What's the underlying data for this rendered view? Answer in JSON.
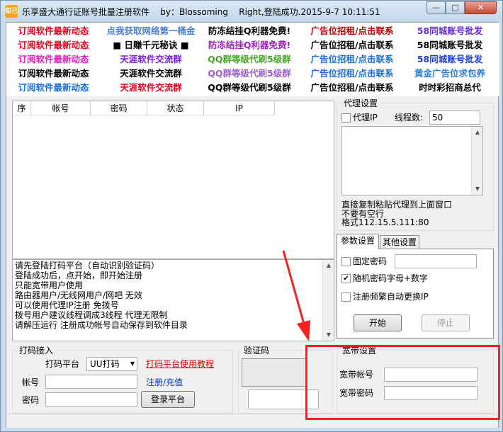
{
  "window": {
    "app_icon": "知己",
    "title": "乐享盛大通行证账号批量注册软件    by：Blossoming    Right,登陆成功.2015-9-7 10:11:51",
    "min_label": "—",
    "max_label": "□",
    "close_label": "✕"
  },
  "ads": [
    [
      {
        "text": "订阅软件最新动态",
        "color": "#e8001c"
      },
      {
        "text": "点我获取网络第一桶金",
        "color": "#4a7fd6"
      },
      {
        "text": "防冻结挂Q利器免费!",
        "color": "#000000"
      },
      {
        "text": "广告位招租/点击联系",
        "color": "#c00000"
      },
      {
        "text": "58同城账号批发",
        "color": "#6a2bd9"
      }
    ],
    [
      {
        "text": "订阅软件最新动态",
        "color": "#e8001c"
      },
      {
        "text": "■  日赚千元秘诀  ■",
        "color": "#000000"
      },
      {
        "text": "防冻结挂Q利器免费!",
        "color": "#a020c0"
      },
      {
        "text": "广告位招租/点击联系",
        "color": "#000000"
      },
      {
        "text": "58同城账号批发",
        "color": "#000000"
      }
    ],
    [
      {
        "text": "订阅软件最新动态",
        "color": "#e020c0"
      },
      {
        "text": "天涯软件交流群",
        "color": "#8020d0"
      },
      {
        "text": "QQ群等级代刷5级群",
        "color": "#44aa22"
      },
      {
        "text": "广告位招租/点击联系",
        "color": "#1a6fd6"
      },
      {
        "text": "58同城账号批发",
        "color": "#1a3fd6"
      }
    ],
    [
      {
        "text": "订阅软件最新动态",
        "color": "#000000"
      },
      {
        "text": "天涯软件交流群",
        "color": "#000000"
      },
      {
        "text": "QQ群等级代刷5级群",
        "color": "#a060d0"
      },
      {
        "text": "广告位招租/点击联系",
        "color": "#1a6fd6"
      },
      {
        "text": "黄金广告位求包养",
        "color": "#2a7fd6"
      }
    ],
    [
      {
        "text": "订阅软件最新动态",
        "color": "#1a6fd6"
      },
      {
        "text": "天涯软件交流群",
        "color": "#e8001c"
      },
      {
        "text": "QQ群等级代刷5级群",
        "color": "#000000"
      },
      {
        "text": "广告位招租/点击联系",
        "color": "#000000"
      },
      {
        "text": "时时彩招商总代",
        "color": "#000000"
      }
    ]
  ],
  "grid": {
    "columns": [
      "序",
      "帐号",
      "密码",
      "状态",
      "IP"
    ]
  },
  "log": {
    "lines": [
      "请先登陆打码平台（自动识别验证码）",
      "登陆成功后，点开始，即开始注册",
      "只能宽带用户使用",
      "路由器用户/无线网用户/网吧 无效",
      "可以使用代理IP注册 免拨号",
      "拨号用户建议线程调成3线程 代理无限制",
      "请解压运行 注册成功帐号自动保存到软件目录"
    ]
  },
  "proxy": {
    "legend": "代理设置",
    "use_proxy_label": "代理IP",
    "threads_label": "线程数:",
    "threads_value": "50",
    "hint1": "直接复制粘贴代理到上面窗口",
    "hint2": "不要有空行",
    "hint3": "格式112.15.5.111:80"
  },
  "tabs": {
    "params": "参数设置",
    "other": "其他设置"
  },
  "params": {
    "fixed_pwd_label": "固定密码",
    "random_pwd_label": "随机密码字母+数字",
    "auto_ip_label": "注册频繁自动更换IP",
    "start": "开始",
    "stop": "停止"
  },
  "captcha_login": {
    "legend": "打码接入",
    "platform_label": "打码平台",
    "platform_value": "UU打码",
    "tutorial_link": "打码平台使用教程",
    "account_label": "帐号",
    "password_label": "密码",
    "register_link": "注册/充值",
    "login_button": "登录平台"
  },
  "captcha": {
    "legend": "验证码"
  },
  "broadband": {
    "legend": "宽带设置",
    "account_label": "宽带帐号",
    "password_label": "宽带密码"
  },
  "colors": {
    "annotation": "#ff1e1e"
  }
}
